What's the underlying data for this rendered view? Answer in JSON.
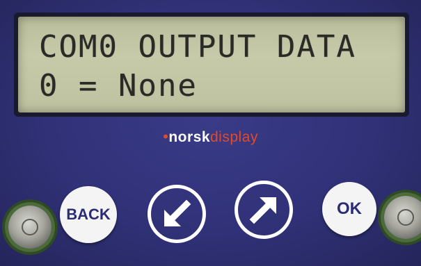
{
  "lcd": {
    "line1": "COM0 OUTPUT DATA",
    "line2": "0 = None"
  },
  "brand": {
    "dot": "•",
    "norsk": "norsk",
    "display": "display"
  },
  "buttons": {
    "back_label": "BACK",
    "ok_label": "OK",
    "left_icon": "arrow-down-left-icon",
    "right_icon": "arrow-up-right-icon"
  },
  "colors": {
    "panel": "#303177",
    "lcd_background": "#c7caa9",
    "lcd_text": "#2a2b26",
    "brand_accent": "#e24a2a",
    "button_face": "#f4f4f4",
    "button_text": "#2b2c74"
  }
}
